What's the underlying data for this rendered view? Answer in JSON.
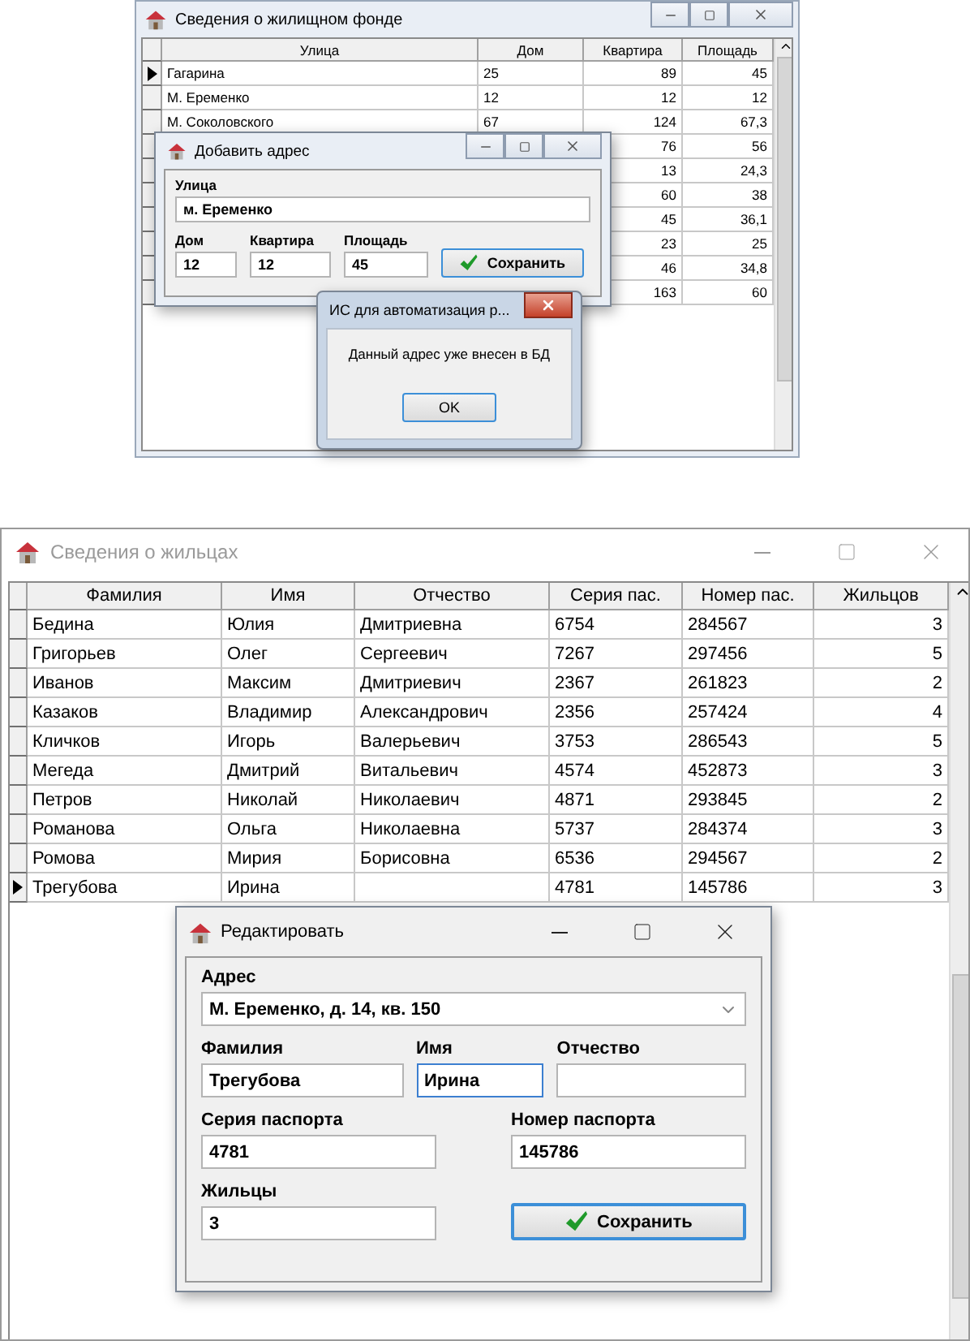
{
  "housing_window": {
    "title": "Сведения о жилищном фонде",
    "columns": [
      "Улица",
      "Дом",
      "Квартира",
      "Площадь"
    ],
    "rows": [
      {
        "street": "Гагарина",
        "house": "25",
        "apartment": "89",
        "area": "45",
        "selected": true
      },
      {
        "street": "М. Еременко",
        "house": "12",
        "apartment": "12",
        "area": "12",
        "selected": false
      },
      {
        "street": "М. Соколовского",
        "house": "67",
        "apartment": "124",
        "area": "67,3",
        "selected": false
      },
      {
        "apartment": "76",
        "area": "56",
        "selected": false
      },
      {
        "apartment": "13",
        "area": "24,3",
        "selected": false
      },
      {
        "apartment": "60",
        "area": "38",
        "selected": false
      },
      {
        "apartment": "45",
        "area": "36,1",
        "selected": false
      },
      {
        "apartment": "23",
        "area": "25",
        "selected": false
      },
      {
        "apartment": "46",
        "area": "34,8",
        "selected": false
      },
      {
        "apartment": "163",
        "area": "60",
        "selected": false
      }
    ]
  },
  "add_dialog": {
    "title": "Добавить адрес",
    "fields": [
      {
        "label": "Улица",
        "value": "м. Еременко"
      },
      {
        "label": "Дом",
        "value": "12"
      },
      {
        "label": "Квартира",
        "value": "12"
      },
      {
        "label": "Площадь",
        "value": "45"
      }
    ],
    "save_button": "Сохранить"
  },
  "message_box": {
    "title": "ИС для автоматизация р...",
    "text": "Данный адрес уже внесен в БД",
    "button": "OK"
  },
  "residents_window": {
    "title": "Сведения о жильцах",
    "active": false,
    "columns": [
      "Фамилия",
      "Имя",
      "Отчество",
      "Серия пас.",
      "Номер пас.",
      "Жильцов"
    ],
    "rows": [
      {
        "cells": [
          "Бедина",
          "Юлия",
          "Дмитриевна",
          "6754",
          "284567",
          "3"
        ],
        "selected": false
      },
      {
        "cells": [
          "Григорьев",
          "Олег",
          "Сергеевич",
          "7267",
          "297456",
          "5"
        ],
        "selected": false
      },
      {
        "cells": [
          "Иванов",
          "Максим",
          "Дмитриевич",
          "2367",
          "261823",
          "2"
        ],
        "selected": false
      },
      {
        "cells": [
          "Казаков",
          "Владимир",
          "Александрович",
          "2356",
          "257424",
          "4"
        ],
        "selected": false
      },
      {
        "cells": [
          "Кличков",
          "Игорь",
          "Валерьевич",
          "3753",
          "286543",
          "5"
        ],
        "selected": false
      },
      {
        "cells": [
          "Мегеда",
          "Дмитрий",
          "Витальевич",
          "4574",
          "452873",
          "3"
        ],
        "selected": false
      },
      {
        "cells": [
          "Петров",
          "Николай",
          "Николаевич",
          "4871",
          "293845",
          "2"
        ],
        "selected": false
      },
      {
        "cells": [
          "Романова",
          "Ольга",
          "Николаевна",
          "5737",
          "284374",
          "3"
        ],
        "selected": false
      },
      {
        "cells": [
          "Ромова",
          "Мирия",
          "Борисовна",
          "6536",
          "294567",
          "2"
        ],
        "selected": false
      },
      {
        "cells": [
          "Трегубова",
          "Ирина",
          null,
          "4781",
          "145786",
          "3"
        ],
        "selected": true
      }
    ]
  },
  "edit_dialog": {
    "title": "Редактировать",
    "address": {
      "label": "Адрес",
      "value": "М. Еременко, д. 14, кв. 150"
    },
    "fields": [
      {
        "label": "Фамилия",
        "value": "Трегубова",
        "focused": false
      },
      {
        "label": "Имя",
        "value": "Ирина",
        "focused": true
      },
      {
        "label": "Отчество",
        "focused": false
      },
      {
        "label": "Серия паспорта",
        "value": "4781",
        "focused": false
      },
      {
        "label": "Номер паспорта",
        "value": "145786",
        "focused": false
      },
      {
        "label": "Жильцы",
        "value": "3",
        "focused": false
      }
    ],
    "save_button": "Сохранить"
  }
}
